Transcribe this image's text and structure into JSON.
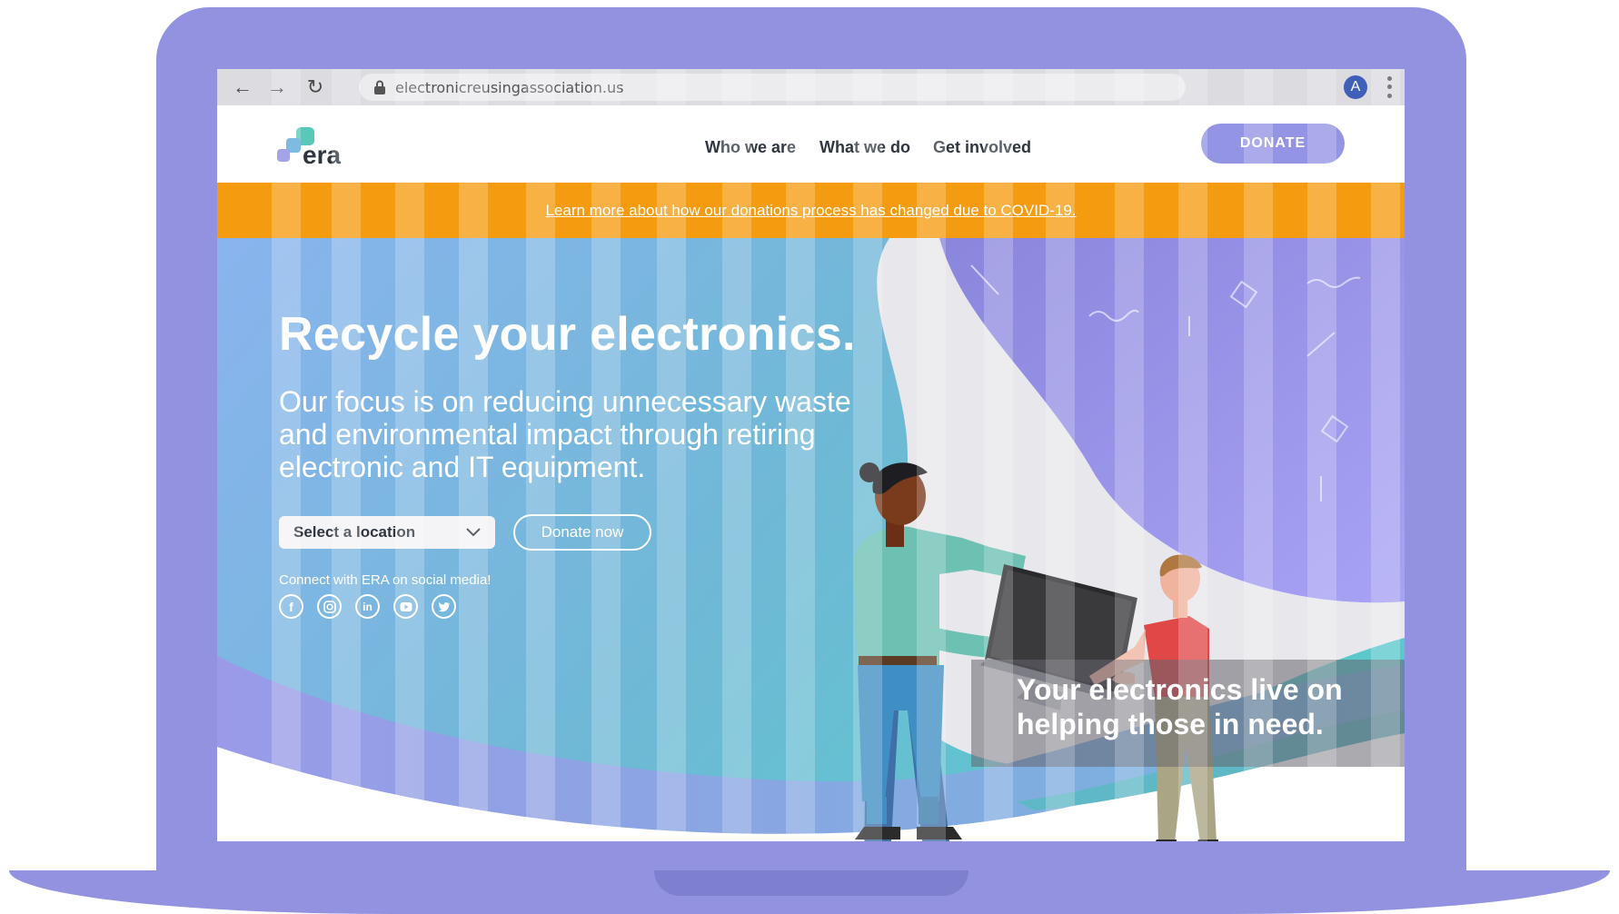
{
  "browser": {
    "url": "electronicreusingassociation.us",
    "profile_initial": "A"
  },
  "header": {
    "logo_text": "era",
    "nav": [
      "Who we are",
      "What we do",
      "Get involved"
    ],
    "donate_label": "DONATE"
  },
  "banner": {
    "text": "Learn more about how our donations process has changed due to COVID-19."
  },
  "hero": {
    "title": "Recycle your electronics.",
    "subtitle": "Our focus is on reducing unnecessary waste and environmental impact through retiring electronic and IT equipment.",
    "location_select": "Select a location",
    "donate_now_label": "Donate now",
    "social_label": "Connect with ERA on social media!",
    "social_icons": [
      "facebook-icon",
      "instagram-icon",
      "linkedin-icon",
      "youtube-icon",
      "twitter-icon"
    ],
    "caption": "Your electronics live on helping those in need."
  },
  "colors": {
    "laptop": "#9292e0",
    "banner": "#f59b10",
    "accent": "#9494e4",
    "hero_teal": "#5ec9d0",
    "hero_blue": "#8aa8ef"
  }
}
